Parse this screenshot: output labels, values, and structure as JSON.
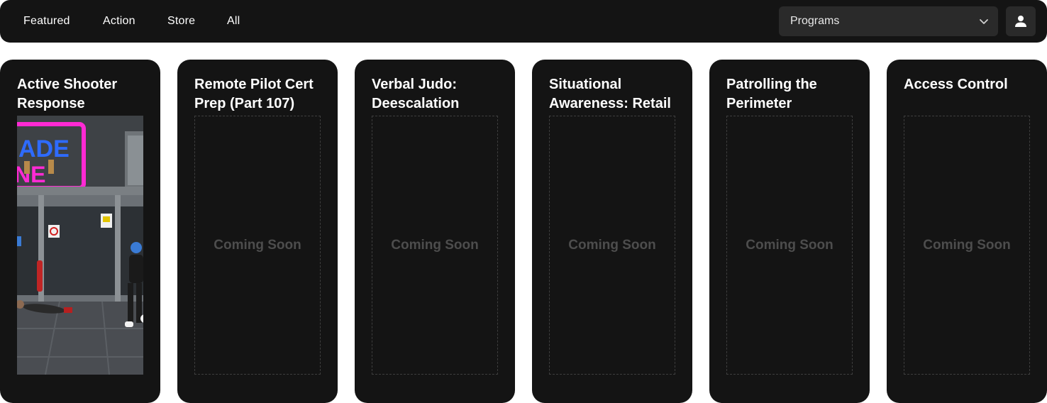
{
  "nav": {
    "items": [
      {
        "label": "Featured"
      },
      {
        "label": "Action"
      },
      {
        "label": "Store"
      },
      {
        "label": "All"
      }
    ]
  },
  "programs_select": {
    "value": "Programs"
  },
  "icons": {
    "dropdown": "chevron-down-icon",
    "profile": "user-icon"
  },
  "cards": [
    {
      "title": "Active Shooter Response",
      "status": ""
    },
    {
      "title": "Remote Pilot Cert Prep (Part 107)",
      "status": "Coming Soon"
    },
    {
      "title": "Verbal Judo: Deescalation",
      "status": "Coming Soon"
    },
    {
      "title": "Situational Awareness: Retail",
      "status": "Coming Soon"
    },
    {
      "title": "Patrolling the Perimeter",
      "status": "Coming Soon"
    },
    {
      "title": "Access Control",
      "status": "Coming Soon"
    }
  ],
  "colors": {
    "bar_bg": "#141414",
    "card_bg": "#141414",
    "control_bg": "#2a2a2a",
    "muted_text": "#4d4d4d",
    "neon_pink": "#ff2ad4",
    "neon_blue": "#2e6bff"
  }
}
